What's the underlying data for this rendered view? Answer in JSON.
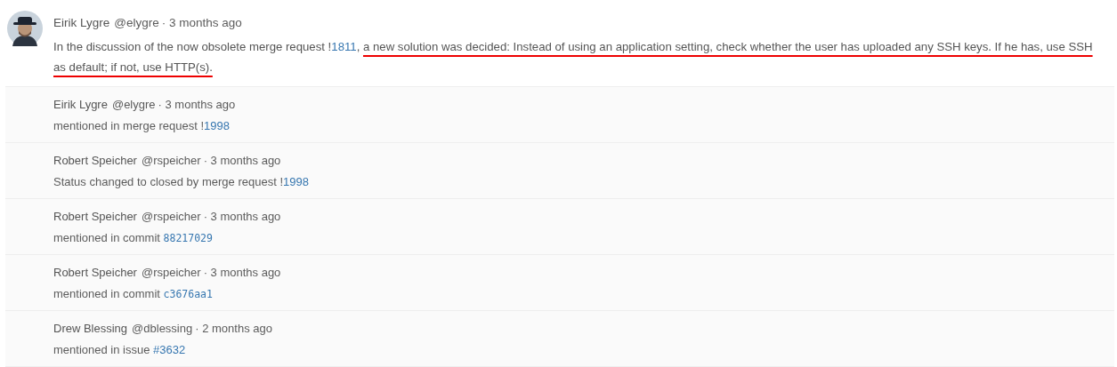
{
  "comment": {
    "author": "Eirik Lygre",
    "handle": "@elygre",
    "time": "· 3 months ago",
    "body": [
      {
        "kind": "text",
        "text": "In the discussion of the now obsolete merge request !"
      },
      {
        "kind": "link",
        "text": "1811"
      },
      {
        "kind": "text",
        "text": ", "
      },
      {
        "kind": "underlined",
        "text": "a new solution was decided: Instead of using an application setting, check whether the user has uploaded any SSH keys. If he has, use SSH as default; if not, use HTTP(s)."
      }
    ]
  },
  "events": [
    {
      "author": "Eirik Lygre",
      "handle": "@elygre",
      "time": "· 3 months ago",
      "text": "mentioned in merge request !",
      "ref": "1998",
      "kind": "plain"
    },
    {
      "author": "Robert Speicher",
      "handle": "@rspeicher",
      "time": "· 3 months ago",
      "text": "Status changed to closed by merge request !",
      "ref": "1998",
      "kind": "plain"
    },
    {
      "author": "Robert Speicher",
      "handle": "@rspeicher",
      "time": "· 3 months ago",
      "text": "mentioned in commit ",
      "ref": "88217029",
      "kind": "code"
    },
    {
      "author": "Robert Speicher",
      "handle": "@rspeicher",
      "time": "· 3 months ago",
      "text": "mentioned in commit ",
      "ref": "c3676aa1",
      "kind": "code"
    },
    {
      "author": "Drew Blessing",
      "handle": "@dblessing",
      "time": "· 2 months ago",
      "text": "mentioned in issue ",
      "ref": "#3632",
      "kind": "plain"
    }
  ]
}
